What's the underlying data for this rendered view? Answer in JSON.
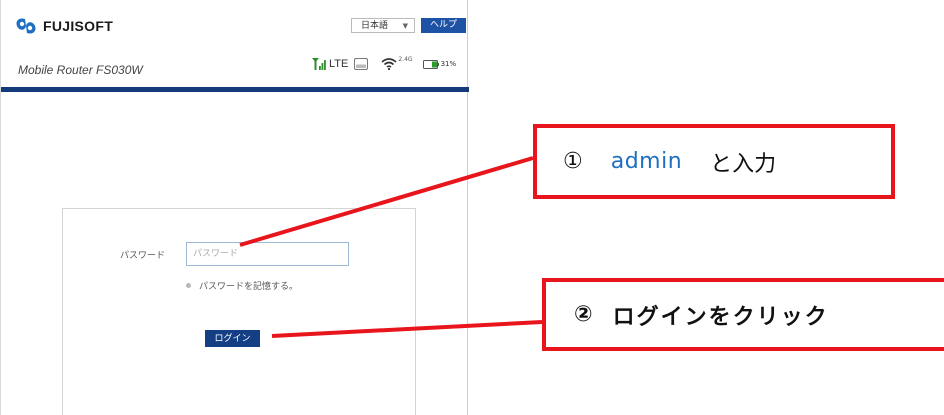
{
  "header": {
    "brand": "FUJISOFT",
    "language_select": "日本語",
    "help_button": "ヘルプ",
    "model_name": "Mobile Router FS030W"
  },
  "status_bar": {
    "icons": [
      "signal-icon",
      "sim-card-icon",
      "wifi-icon",
      "battery-icon"
    ],
    "network_type": "LTE",
    "wifi_band": "2.4G",
    "battery_percent": "31%",
    "battery_level": 0.31
  },
  "login": {
    "password_label": "パスワード",
    "password_placeholder": "パスワード",
    "password_value": "",
    "remember_label": "パスワードを記憶する。",
    "login_button": "ログイン"
  },
  "callouts": {
    "step1": {
      "number": "①",
      "keyword": "admin",
      "text": "と入力"
    },
    "step2": {
      "number": "②",
      "text": "ログインをクリック"
    }
  },
  "colors": {
    "brand_blue": "#1d52a5",
    "navbar": "#133b7a",
    "callout_red": "#e8161c",
    "keyword_blue": "#1f6fc0"
  }
}
